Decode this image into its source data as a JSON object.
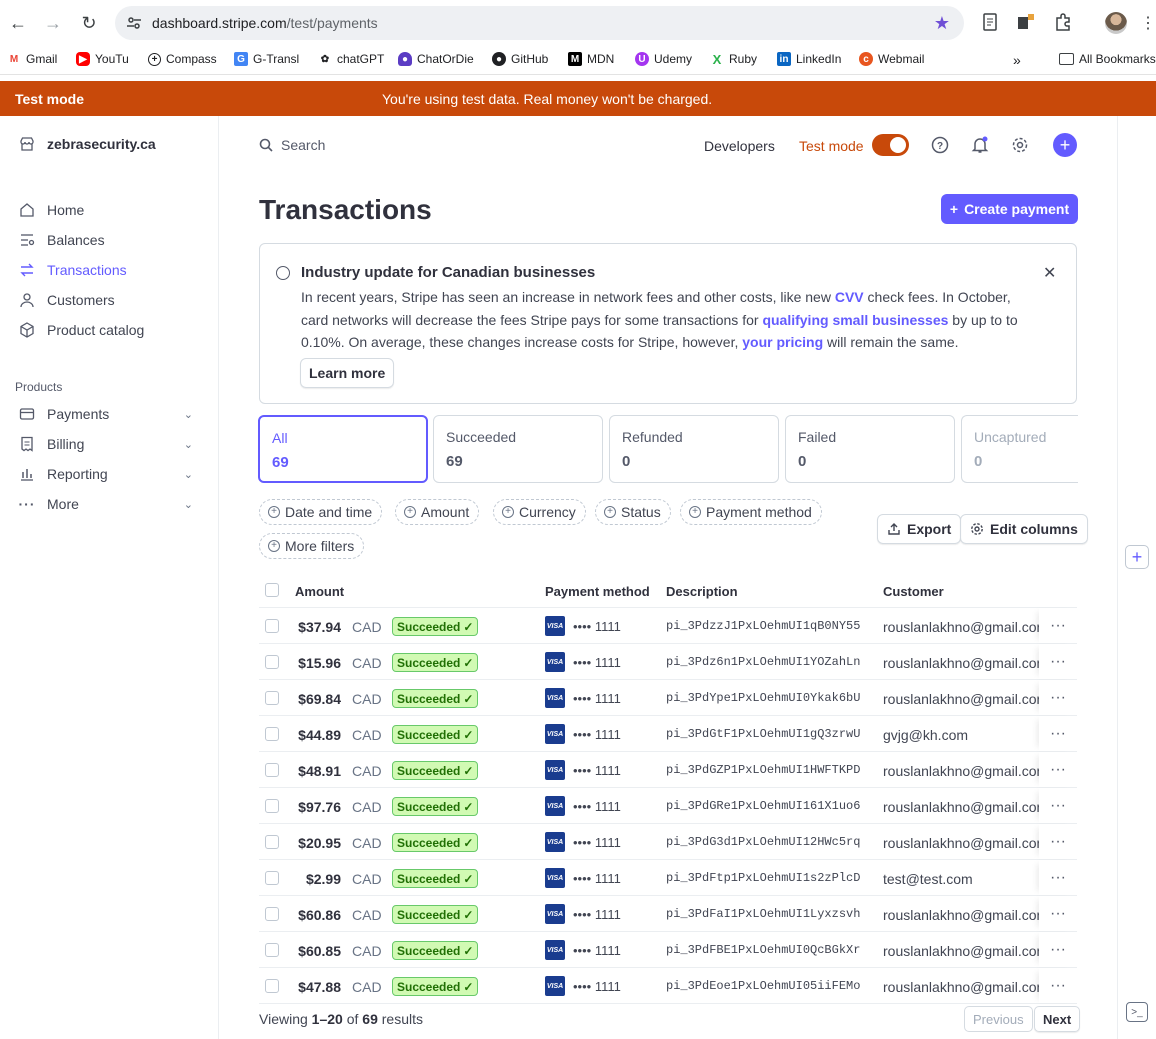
{
  "browser": {
    "url_host": "dashboard.stripe.com",
    "url_path": "/test/payments",
    "bookmarks": [
      {
        "label": "Gmail",
        "icon": "gmail-icon",
        "color": "#ea4335"
      },
      {
        "label": "YouTu",
        "icon": "youtube-icon",
        "color": "#ff0000"
      },
      {
        "label": "Compass",
        "icon": "compass-icon",
        "color": "#202124"
      },
      {
        "label": "G-Transl",
        "icon": "translate-icon",
        "color": "#4285f4"
      },
      {
        "label": "chatGPT",
        "icon": "openai-icon",
        "color": "#202124"
      },
      {
        "label": "ChatOrDie",
        "icon": "chat-icon",
        "color": "#5b3cc4"
      },
      {
        "label": "GitHub",
        "icon": "github-icon",
        "color": "#202124"
      },
      {
        "label": "MDN",
        "icon": "mdn-icon",
        "color": "#000000"
      },
      {
        "label": "Udemy",
        "icon": "udemy-icon",
        "color": "#a435f0"
      },
      {
        "label": "Ruby",
        "icon": "ruby-icon",
        "color": "#2bb24c"
      },
      {
        "label": "LinkedIn",
        "icon": "linkedin-icon",
        "color": "#0a66c2"
      },
      {
        "label": "Webmail",
        "icon": "webmail-icon",
        "color": "#e8561f"
      }
    ],
    "all_bookmarks": "All Bookmarks"
  },
  "banner": {
    "left": "Test mode",
    "message": "You're using test data. Real money won't be charged.",
    "color": "#c8490a"
  },
  "sidebar": {
    "account": "zebrasecurity.ca",
    "items": [
      {
        "label": "Home",
        "icon": "home-icon"
      },
      {
        "label": "Balances",
        "icon": "balances-icon"
      },
      {
        "label": "Transactions",
        "icon": "transactions-icon",
        "active": true
      },
      {
        "label": "Customers",
        "icon": "customers-icon"
      },
      {
        "label": "Product catalog",
        "icon": "product-catalog-icon"
      }
    ],
    "section_label": "Products",
    "product_items": [
      {
        "label": "Payments",
        "icon": "payments-icon"
      },
      {
        "label": "Billing",
        "icon": "billing-icon"
      },
      {
        "label": "Reporting",
        "icon": "reporting-icon"
      },
      {
        "label": "More",
        "icon": "more-icon"
      }
    ]
  },
  "header": {
    "search_placeholder": "Search",
    "developers": "Developers",
    "test_mode_label": "Test mode",
    "test_mode_on": true
  },
  "page": {
    "title": "Transactions",
    "create_button": "Create payment",
    "accent": "#635bff"
  },
  "notice": {
    "title": "Industry update for Canadian businesses",
    "body_1": "In recent years, Stripe has seen an increase in network fees and other costs, like new ",
    "link_cvv": "CVV",
    "body_2": " check fees. In October, card networks will decrease the fees Stripe pays for some transactions for ",
    "link_qualifying": "qualifying small businesses",
    "body_3": " by up to to 0.10%. On average, these changes increase costs for Stripe, however, ",
    "link_pricing": "your pricing",
    "body_4": " will remain the same.",
    "learn_more": "Learn more"
  },
  "stats": [
    {
      "label": "All",
      "value": "69"
    },
    {
      "label": "Succeeded",
      "value": "69"
    },
    {
      "label": "Refunded",
      "value": "0"
    },
    {
      "label": "Failed",
      "value": "0"
    },
    {
      "label": "Uncaptured",
      "value": "0"
    }
  ],
  "filters": [
    "Date and time",
    "Amount",
    "Currency",
    "Status",
    "Payment method",
    "More filters"
  ],
  "toolbar": {
    "export": "Export",
    "edit_columns": "Edit columns"
  },
  "table": {
    "columns": [
      "Amount",
      "Payment method",
      "Description",
      "Customer"
    ],
    "rows": [
      {
        "amount": "$37.94",
        "currency": "CAD",
        "status": "Succeeded",
        "card": "•••• 1111",
        "description": "pi_3PdzzJ1PxLOehmUI1qB0NY55",
        "customer": "rouslanlakhno@gmail.com"
      },
      {
        "amount": "$15.96",
        "currency": "CAD",
        "status": "Succeeded",
        "card": "•••• 1111",
        "description": "pi_3Pdz6n1PxLOehmUI1YOZahLn",
        "customer": "rouslanlakhno@gmail.com"
      },
      {
        "amount": "$69.84",
        "currency": "CAD",
        "status": "Succeeded",
        "card": "•••• 1111",
        "description": "pi_3PdYpe1PxLOehmUI0Ykak6bU",
        "customer": "rouslanlakhno@gmail.com"
      },
      {
        "amount": "$44.89",
        "currency": "CAD",
        "status": "Succeeded",
        "card": "•••• 1111",
        "description": "pi_3PdGtF1PxLOehmUI1gQ3zrwU",
        "customer": "gvjg@kh.com"
      },
      {
        "amount": "$48.91",
        "currency": "CAD",
        "status": "Succeeded",
        "card": "•••• 1111",
        "description": "pi_3PdGZP1PxLOehmUI1HWFTKPD",
        "customer": "rouslanlakhno@gmail.com"
      },
      {
        "amount": "$97.76",
        "currency": "CAD",
        "status": "Succeeded",
        "card": "•••• 1111",
        "description": "pi_3PdGRe1PxLOehmUI161X1uo6",
        "customer": "rouslanlakhno@gmail.com"
      },
      {
        "amount": "$20.95",
        "currency": "CAD",
        "status": "Succeeded",
        "card": "•••• 1111",
        "description": "pi_3PdG3d1PxLOehmUI12HWc5rq",
        "customer": "rouslanlakhno@gmail.com"
      },
      {
        "amount": "$2.99",
        "currency": "CAD",
        "status": "Succeeded",
        "card": "•••• 1111",
        "description": "pi_3PdFtp1PxLOehmUI1s2zPlcD",
        "customer": "test@test.com"
      },
      {
        "amount": "$60.86",
        "currency": "CAD",
        "status": "Succeeded",
        "card": "•••• 1111",
        "description": "pi_3PdFaI1PxLOehmUI1Lyxzsvh",
        "customer": "rouslanlakhno@gmail.com"
      },
      {
        "amount": "$60.85",
        "currency": "CAD",
        "status": "Succeeded",
        "card": "•••• 1111",
        "description": "pi_3PdFBE1PxLOehmUI0QcBGkXr",
        "customer": "rouslanlakhno@gmail.com"
      },
      {
        "amount": "$47.88",
        "currency": "CAD",
        "status": "Succeeded",
        "card": "•••• 1111",
        "description": "pi_3PdEoe1PxLOehmUI05iiFEMo",
        "customer": "rouslanlakhno@gmail.com"
      }
    ]
  },
  "pagination": {
    "viewing": "Viewing",
    "range": "1–20",
    "of": "of",
    "total": "69",
    "results": "results",
    "previous": "Previous",
    "next": "Next"
  }
}
